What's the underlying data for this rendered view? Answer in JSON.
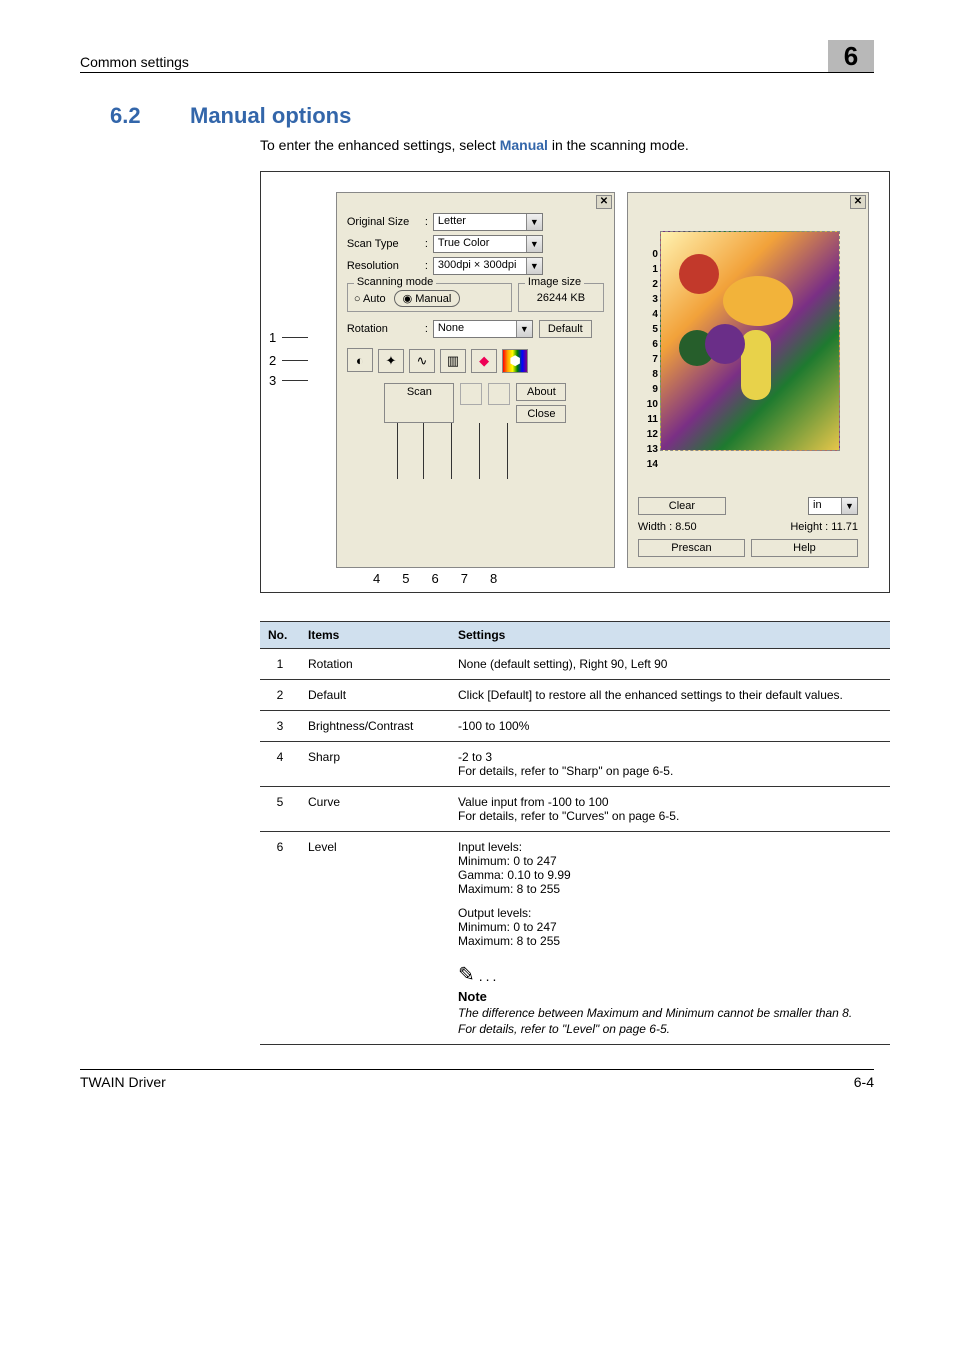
{
  "header": {
    "left": "Common settings",
    "chapter": "6"
  },
  "section": {
    "number": "6.2",
    "title": "Manual options"
  },
  "intro": {
    "pre": "To enter the enhanced settings, select ",
    "hl": "Manual",
    "post": " in the scanning mode."
  },
  "dlg": {
    "original_size_label": "Original Size",
    "original_size_value": "Letter",
    "scan_type_label": "Scan Type",
    "scan_type_value": "True Color",
    "resolution_label": "Resolution",
    "resolution_value": "300dpi × 300dpi",
    "scanning_mode_label": "Scanning mode",
    "auto_label": "Auto",
    "manual_label": "Manual",
    "image_size_label": "Image size",
    "image_size_value": "26244 KB",
    "rotation_label": "Rotation",
    "rotation_value": "None",
    "default_btn": "Default",
    "scan_btn": "Scan",
    "about_btn": "About",
    "close_btn": "Close"
  },
  "preview": {
    "clear_btn": "Clear",
    "unit_value": "in",
    "width_label": "Width : 8.50",
    "height_label": "Height : 11.71",
    "prescan_btn": "Prescan",
    "help_btn": "Help"
  },
  "callouts": {
    "left": [
      "1",
      "2",
      "3"
    ],
    "bottom": [
      "4",
      "5",
      "6",
      "7",
      "8"
    ]
  },
  "table": {
    "head": {
      "no": "No.",
      "items": "Items",
      "settings": "Settings"
    },
    "rows": [
      {
        "no": "1",
        "item": "Rotation",
        "settings": "None (default setting), Right 90, Left 90"
      },
      {
        "no": "2",
        "item": "Default",
        "settings": "Click [Default] to restore all the enhanced settings to their default values."
      },
      {
        "no": "3",
        "item": "Brightness/Contrast",
        "settings": "-100 to 100%"
      },
      {
        "no": "4",
        "item": "Sharp",
        "settings_l1": "-2 to 3",
        "settings_l2": "For details, refer to \"Sharp\" on page 6-5."
      },
      {
        "no": "5",
        "item": "Curve",
        "settings_l1": "Value input from -100 to 100",
        "settings_l2": "For details, refer to \"Curves\" on page 6-5."
      },
      {
        "no": "6",
        "item": "Level",
        "l1": "Input levels:",
        "l2": "Minimum: 0 to 247",
        "l3": "Gamma: 0.10 to 9.99",
        "l4": "Maximum: 8 to 255",
        "l5": "Output levels:",
        "l6": "Minimum: 0 to 247",
        "l7": "Maximum: 8 to 255",
        "note_label": "Note",
        "note_l1": "The difference between Maximum and Minimum cannot be smaller than 8.",
        "note_l2": "For details, refer to \"Level\" on page 6-5."
      }
    ]
  },
  "footer": {
    "left": "TWAIN Driver",
    "right": "6-4"
  }
}
